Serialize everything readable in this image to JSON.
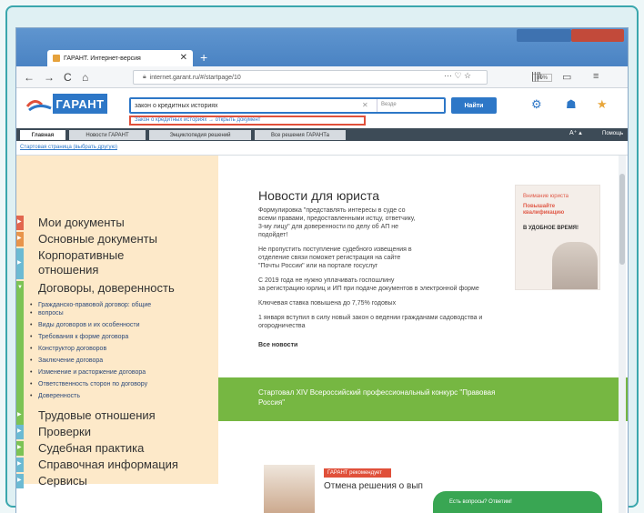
{
  "browser": {
    "tab_title": "ГАРАНТ. Интернет-версия",
    "tab_close": "✕",
    "new_tab": "+",
    "url": "internet.garant.ru/#/startpage/10",
    "zoom": "80%",
    "nav": {
      "back": "←",
      "forward": "→",
      "reload": "C",
      "home": "⌂"
    },
    "url_icons": "··· ♡ ☆",
    "tools": {
      "library": "|||\\",
      "sidebar": "▭",
      "menu": "≡"
    }
  },
  "site": {
    "logo": "ГАРАНТ",
    "search_value": "закон о кредитных историях",
    "search_clear": "✕",
    "search_scope": "Везде",
    "find_button": "Найти",
    "suggestion": "Закон о кредитных историях → открыть документ"
  },
  "menu": {
    "tabs": [
      "Главная",
      "Новости ГАРАНТ",
      "Энциклопедия решений",
      "Все решения ГАРАНТа"
    ],
    "font_size": "A⁺ ▴",
    "right_link": "Помощь"
  },
  "start_link": "Стартовая страница (выбрать другую)",
  "sidebar": {
    "items_top": [
      {
        "label": "Мои документы",
        "color": "#e2664e"
      },
      {
        "label": "Основные документы",
        "color": "#e8944a"
      },
      {
        "label": "Корпоративные",
        "color": "#6cbad3"
      },
      {
        "label": "отношения",
        "color": ""
      },
      {
        "label": "Договоры, доверенность",
        "color": "#7cc354"
      }
    ],
    "sub_items": [
      "Гражданско-правовой договор: общие",
      "вопросы",
      "Виды договоров и их особенности",
      "Требования к форме договора",
      "Конструктор договоров",
      "Заключение договора",
      "Изменение и расторжение договора",
      "Ответственность сторон по договору",
      "Доверенность"
    ],
    "items_bottom": [
      {
        "label": "Трудовые отношения",
        "color": "#7cc354"
      },
      {
        "label": "Проверки",
        "color": "#6cbad3"
      },
      {
        "label": "Судебная практика",
        "color": "#7cc354"
      },
      {
        "label": "Справочная информация",
        "color": "#6cbad3"
      },
      {
        "label": "Сервисы",
        "color": "#6cbad3"
      }
    ]
  },
  "news": {
    "title": "Новости для юриста",
    "items": [
      "Формулировка \"представлять интересы в суде со",
      "всеми правами, предоставленными истцу, ответчику,",
      "3-му лицу\" для доверенности по делу об АП не",
      "подойдет!",
      "Не пропустить поступление судебного извещения в",
      "отделение связи поможет регистрация на сайте",
      "\"Почты России\" или на портале госуслуг",
      "С 2019 года не нужно уплачивать госпошлину",
      "за регистрацию юрлиц и ИП при подаче документов в электронной форме",
      "Ключевая ставка повышена до 7,75% годовых",
      "1 января вступил в силу новый закон о ведении гражданами садоводства и",
      "огородничества"
    ],
    "all_news": "Все новости"
  },
  "ad": {
    "line1": "Внимание юриста",
    "line2": "Повышайте квалификацию",
    "line3": "В УДОБНОЕ ВРЕМЯ!"
  },
  "banner": {
    "line1": "Стартовал XIV Всероссийский профессиональный конкурс \"Правовая",
    "line2": "Россия\""
  },
  "bottom": {
    "badge": "ГАРАНТ рекомендует",
    "title": "Отмена решения о вып"
  },
  "chat": "Есть вопросы? Ответим!"
}
